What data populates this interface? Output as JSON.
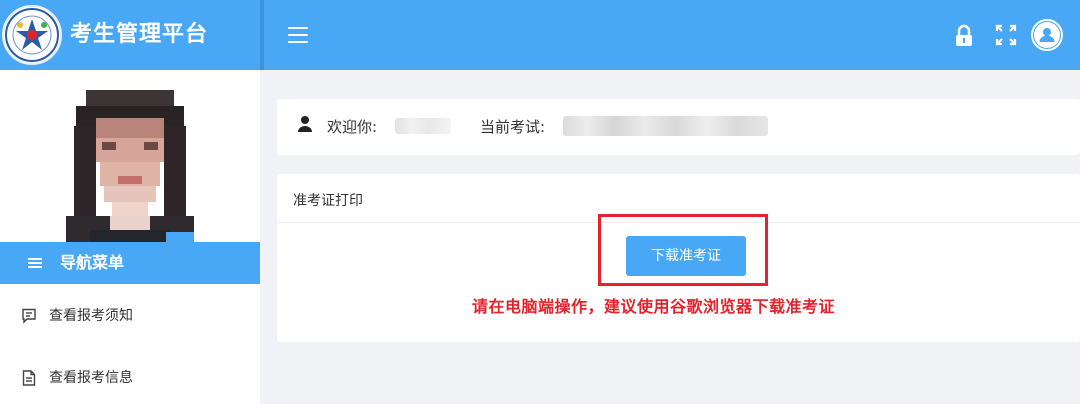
{
  "header": {
    "app_title": "考生管理平台",
    "icons": [
      "logo",
      "menu-icon",
      "lock-icon",
      "fullscreen-icon",
      "user-icon"
    ],
    "accent_color": "#49a8f6"
  },
  "sidebar": {
    "nav_title": "导航菜单",
    "items": [
      {
        "label": "查看报考须知",
        "icon": "message-icon"
      },
      {
        "label": "查看报考信息",
        "icon": "document-icon"
      }
    ]
  },
  "welcome": {
    "greeting_label": "欢迎你:",
    "exam_label": "当前考试:"
  },
  "print_panel": {
    "title": "准考证打印",
    "download_button": "下载准考证",
    "notice": "请在电脑端操作，建议使用谷歌浏览器下载准考证",
    "highlight_color": "#e3242b"
  }
}
